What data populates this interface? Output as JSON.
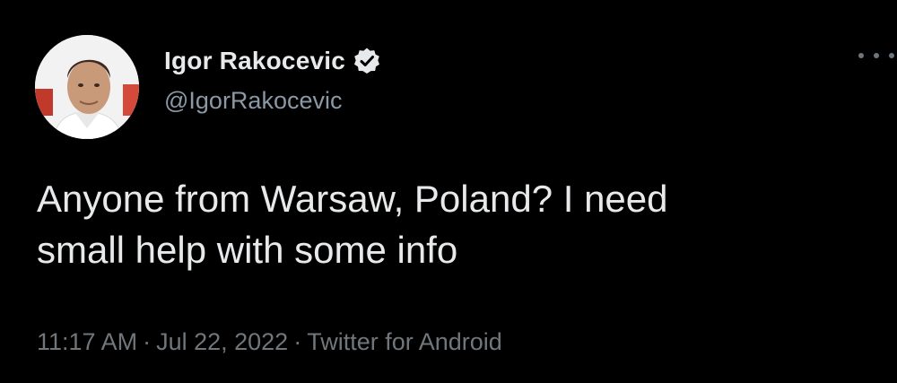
{
  "tweet": {
    "author": {
      "name": "Igor Rakocevic",
      "handle": "@IgorRakocevic",
      "verified": true,
      "avatar_icon": "profile-photo"
    },
    "more_icon": "more-options-icon",
    "text_lines": [
      "Anyone from Warsaw, Poland? I need",
      "small help with some info"
    ],
    "time": "11:17 AM",
    "date": "Jul 22, 2022",
    "source": "Twitter for Android",
    "separator": "·"
  },
  "colors": {
    "background": "#000000",
    "text": "#e7e9ea",
    "secondary": "#71767b",
    "verified_badge": "#e7e9ea"
  }
}
